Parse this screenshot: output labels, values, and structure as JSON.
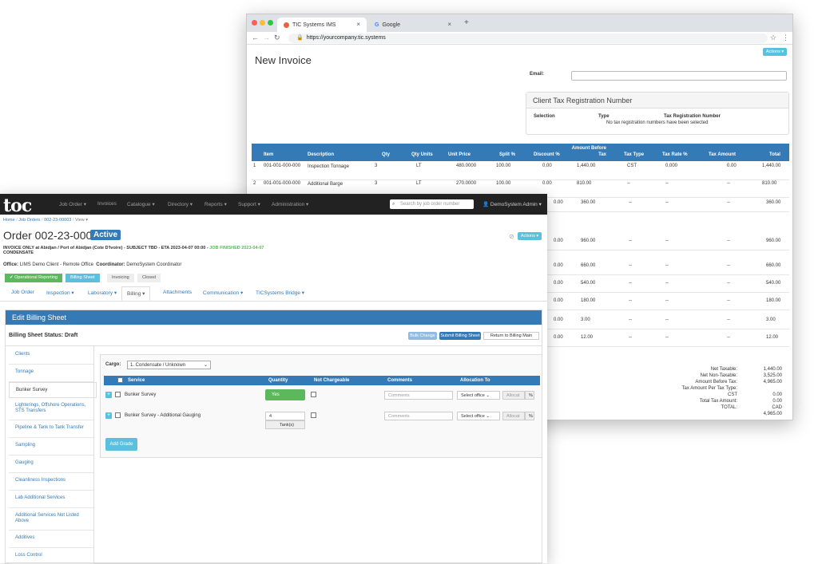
{
  "browser": {
    "tabs": [
      {
        "label": "TIC Systems IMS"
      },
      {
        "label": "Google"
      }
    ],
    "new_tab": "+",
    "url": "https://yourcompany.tic.systems",
    "page_title": "New Invoice",
    "actions": "Actions ▾",
    "email_label": "Email:",
    "tax_panel": {
      "title": "Client Tax Registration Number",
      "col_selection": "Selection",
      "col_type": "Type",
      "col_trn": "Tax Registration Number",
      "empty": "No tax registration numbers have been selected"
    },
    "table_headers": {
      "item": "Item",
      "description": "Description",
      "qty": "Qty",
      "qty_units": "Qty Units",
      "unit_price": "Unit Price",
      "split": "Split %",
      "discount": "Discount %",
      "amount_before_tax": "Amount Before Tax",
      "tax_type": "Tax Type",
      "tax_rate": "Tax Rate %",
      "tax_amount": "Tax Amount",
      "total": "Total"
    },
    "rows": [
      {
        "n": "1",
        "item": "001-001-000-000",
        "desc": "Inspection Tonnage",
        "qty": "3",
        "units": "LT",
        "price": "480.0000",
        "split": "100.00",
        "discount": "0.00",
        "abt": "1,440.00",
        "tax_type": "CST",
        "tax_rate": "0.000",
        "tax_amount": "0.00",
        "total": "1,440.00"
      },
      {
        "n": "2",
        "item": "001-001-000-000",
        "desc": "Additional Barge",
        "qty": "3",
        "units": "LT",
        "price": "270.0000",
        "split": "100.00",
        "discount": "0.00",
        "abt": "810.00",
        "tax_type": "--",
        "tax_rate": "--",
        "tax_amount": "--",
        "total": "810.00"
      }
    ],
    "partial_rows": [
      {
        "discount": "0.00",
        "abt": "360.00",
        "tax_type": "--",
        "tax_rate": "--",
        "tax_amount": "--",
        "total": "360.00"
      },
      {
        "discount": "0.00",
        "abt": "960.00",
        "tax_type": "--",
        "tax_rate": "--",
        "tax_amount": "--",
        "total": "960.00"
      },
      {
        "discount": "0.00",
        "abt": "660.00",
        "tax_type": "--",
        "tax_rate": "--",
        "tax_amount": "--",
        "total": "660.00"
      },
      {
        "discount": "0.00",
        "abt": "540.00",
        "tax_type": "--",
        "tax_rate": "--",
        "tax_amount": "--",
        "total": "540.00"
      },
      {
        "discount": "0.00",
        "abt": "180.00",
        "tax_type": "--",
        "tax_rate": "--",
        "tax_amount": "--",
        "total": "180.00"
      },
      {
        "discount": "0.00",
        "abt": "3.00",
        "tax_type": "--",
        "tax_rate": "--",
        "tax_amount": "--",
        "total": "3.00"
      },
      {
        "discount": "0.00",
        "abt": "12.00",
        "tax_type": "--",
        "tax_rate": "--",
        "tax_amount": "--",
        "total": "12.00"
      }
    ],
    "totals": [
      {
        "label": "Net Taxable:",
        "value": "1,440.00"
      },
      {
        "label": "Net Non-Taxable:",
        "value": "3,525.00"
      },
      {
        "label": "Amount Before Tax:",
        "value": "4,965.00"
      },
      {
        "label": "Tax Amount Per Tax Type:",
        "value": ""
      },
      {
        "label": "CST",
        "value": "0.00"
      },
      {
        "label": "Total Tax Amount:",
        "value": "0.00"
      },
      {
        "label": "TOTAL:",
        "value": "CAD"
      },
      {
        "label": "",
        "value": "4,965.00"
      }
    ]
  },
  "toc": {
    "logo": "toc",
    "nav": [
      "Job Order ▾",
      "Invoices",
      "Catalogue ▾",
      "Directory ▾",
      "Reports ▾",
      "Support ▾",
      "Administration ▾"
    ],
    "search_placeholder": "Search by job order number",
    "user": "DemoSystem Admin ▾",
    "breadcrumb": [
      "Home",
      "Job Orders",
      "002-23-00003",
      "View ▾"
    ],
    "order_title": "Order 002-23-00003",
    "badge": "Active",
    "actions": "Actions ▾",
    "subtitle": "INVOICE ONLY at Abidjan / Port of Abidjan (Cote D'Ivoire) - SUBJECT TBD - ETA 2023-04-07 00:00 -",
    "job_finished": "JOB FINISHED 2023-04-07",
    "subtitle2": "CONDENSATE",
    "office_label": "Office:",
    "office": "LIMS Demo Client - Remote Office",
    "coord_label": "Coordinator:",
    "coordinator": "DemoSystem Coordinator",
    "wizard": [
      "✔ Operational Reporting",
      "Billing Sheet",
      "Invoicing",
      "Closed"
    ],
    "tabs": [
      "Job Order",
      "Inspection ▾",
      "Laboratory ▾",
      "Billing ▾",
      "Attachments",
      "Communication ▾",
      "TICSystems Bridge ▾"
    ],
    "edit_title": "Edit Billing Sheet",
    "status": "Billing Sheet Status: Draft",
    "buttons": {
      "bulk": "Bulk Change",
      "submit": "Submit Billing Sheet",
      "return": "Return to Billing Main",
      "add_grade": "Add Grade"
    },
    "sidebar": [
      "Clients",
      "Tonnage",
      "Bunker Survey",
      "Lighterings, Offshore Operations, STS Transfers",
      "Pipeline & Tank to Tank Transfer",
      "Sampling",
      "Gauging",
      "Cleanliness Inspections",
      "Lab Additional Services",
      "Additional Services Not Listed Above",
      "Additives",
      "Loss Control"
    ],
    "cargo_label": "Cargo:",
    "cargo_value": "1. Condensate / Unknown",
    "svc_headers": {
      "service": "Service",
      "quantity": "Quantity",
      "not_chargeable": "Not Chargeable",
      "comments": "Comments",
      "allocation": "Allocation To"
    },
    "services": [
      {
        "name": "Bunker Survey",
        "qty": "Yes",
        "comments": "Comments",
        "office": "Select office",
        "allocat": "Allocat",
        "pct": "%"
      },
      {
        "name": "Bunker Survey - Additional Gauging",
        "qty": "4",
        "unit": "Tank(s)",
        "comments": "Comments",
        "office": "Select office",
        "allocat": "Allocat",
        "pct": "%"
      }
    ]
  },
  "colors": {
    "primary": "#337ab7",
    "info": "#5bc0de",
    "success": "#5cb85c",
    "navbar": "#222222"
  }
}
